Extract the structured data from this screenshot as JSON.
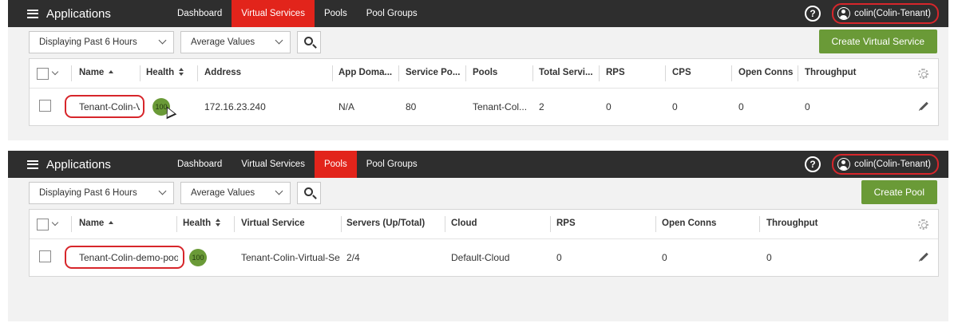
{
  "panel1": {
    "app_title": "Applications",
    "nav": [
      "Dashboard",
      "Virtual Services",
      "Pools",
      "Pool Groups"
    ],
    "active_tab": "Virtual Services",
    "user": "colin(Colin-Tenant)",
    "help_icon": "?",
    "time_range": "Displaying Past 6 Hours",
    "value_mode": "Average Values",
    "create_button": "Create Virtual Service",
    "columns": [
      "Name",
      "Health",
      "Address",
      "App Doma...",
      "Service Po...",
      "Pools",
      "Total Servi...",
      "RPS",
      "CPS",
      "Open Conns",
      "Throughput"
    ],
    "row": {
      "name": "Tenant-Colin-V",
      "health": "100",
      "address": "172.16.23.240",
      "app_domain": "N/A",
      "service_port": "80",
      "pools": "Tenant-Col...",
      "total_servers": "2",
      "rps": "0",
      "cps": "0",
      "open_conns": "0",
      "throughput": "0"
    }
  },
  "panel2": {
    "app_title": "Applications",
    "nav": [
      "Dashboard",
      "Virtual Services",
      "Pools",
      "Pool Groups"
    ],
    "active_tab": "Pools",
    "user": "colin(Colin-Tenant)",
    "help_icon": "?",
    "time_range": "Displaying Past 6 Hours",
    "value_mode": "Average Values",
    "create_button": "Create Pool",
    "columns": [
      "Name",
      "Health",
      "Virtual Service",
      "Servers (Up/Total)",
      "Cloud",
      "RPS",
      "Open Conns",
      "Throughput"
    ],
    "row": {
      "name": "Tenant-Colin-demo-poo",
      "health": "100",
      "virtual_service": "Tenant-Colin-Virtual-Se",
      "servers": "2/4",
      "cloud": "Default-Cloud",
      "rps": "0",
      "open_conns": "0",
      "throughput": "0"
    }
  },
  "colors": {
    "topbar": "#2e2e2e",
    "active_tab": "#e2241b",
    "accent_green": "#6a9a37",
    "highlight_outline": "#d7262b"
  }
}
